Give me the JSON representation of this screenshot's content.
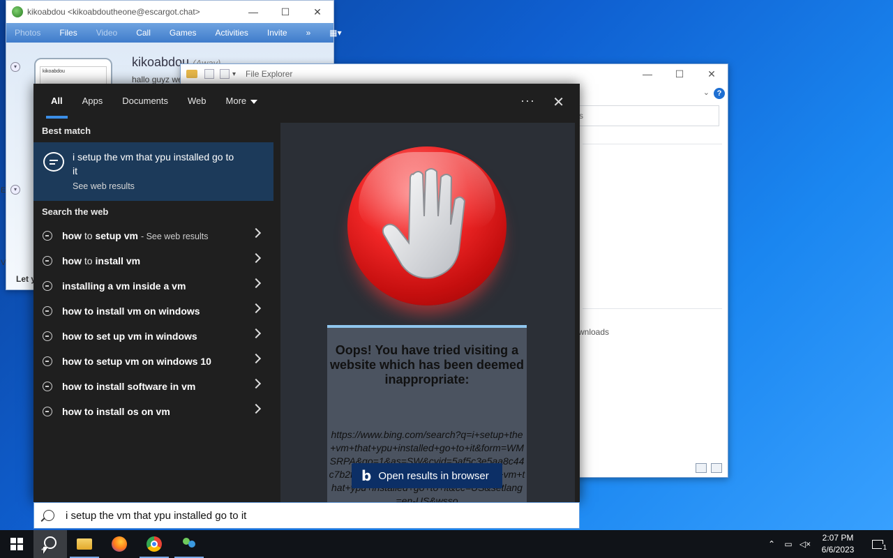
{
  "messenger": {
    "title": "kikoabdou <kikoabdoutheone@escargot.chat>",
    "tabs": [
      "Photos",
      "Files",
      "Video",
      "Call",
      "Games",
      "Activities",
      "Invite"
    ],
    "tabs_more": "»",
    "display_name": "kikoabdou",
    "status_suffix": "(Away)",
    "personal_message": "hallo guyz we",
    "avatar_caption": "kikoabdou",
    "footer_text": "Let y",
    "side_letter_e": "E",
    "side_letter_v": "V"
  },
  "file_explorer": {
    "title": "File Explorer",
    "search_fragment": "s",
    "downloads_label": "wnloads"
  },
  "search": {
    "tabs": [
      "All",
      "Apps",
      "Documents",
      "Web",
      "More"
    ],
    "more_dots": "···",
    "best_match_header": "Best match",
    "best_match_title": "i setup the vm that ypu installed go to it",
    "best_match_sub": "See web results",
    "web_header": "Search the web",
    "suggestions": [
      {
        "bold": "how",
        "rest": " to ",
        "bold2": "setup vm",
        "suffix": "- See web results"
      },
      {
        "bold": "how",
        "rest": " to ",
        "bold2": "install vm",
        "suffix": ""
      },
      {
        "bold": "installing a vm",
        "rest": " ",
        "bold2": "inside a vm",
        "suffix": ""
      },
      {
        "bold": "how to install vm",
        "rest": " ",
        "bold2": "on windows",
        "suffix": ""
      },
      {
        "bold": "how to",
        "rest": " ",
        "bold2": "set up vm in windows",
        "suffix": ""
      },
      {
        "bold": "how to setup vm",
        "rest": " ",
        "bold2": "on windows 10",
        "suffix": ""
      },
      {
        "bold": "how to install software",
        "rest": " ",
        "bold2": "in vm",
        "suffix": ""
      },
      {
        "bold": "how to install os",
        "rest": " ",
        "bold2": "on vm",
        "suffix": ""
      }
    ],
    "preview": {
      "warning_title": "Oops! You have tried visiting a website which has been deemed inappropriate:",
      "blocked_url": "https://www.bing.com/search?q=i+setup+the+vm+that+ypu+installed+go+to+it&form=WMSRPA&qo=1&as=SW&cvid=5af5c3e5aa8c44c7b2fd0de5d0ab3a86&pq=i+setup+the+vm+that+ypu+installed+go+to+it&cc=US&setlang=en-US&wsso",
      "open_button": "Open results in browser"
    },
    "query": "i setup the vm that ypu installed go to it"
  },
  "taskbar": {
    "time": "2:07 PM",
    "date": "6/6/2023",
    "notification_count": "1"
  }
}
